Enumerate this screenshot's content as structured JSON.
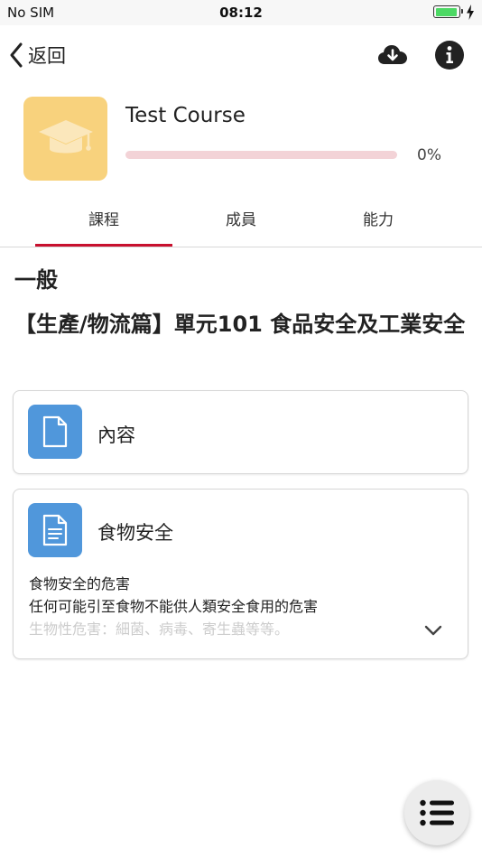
{
  "status_bar": {
    "carrier": "No SIM",
    "time": "08:12",
    "battery_color": "#4cd964"
  },
  "header": {
    "back_label": "返回",
    "download_icon": "cloud-download-icon",
    "info_icon": "info-icon"
  },
  "course": {
    "title": "Test Course",
    "progress_text": "0%",
    "progress_value": 0,
    "image_color": "#f8d27d",
    "image_icon": "graduation-cap-icon"
  },
  "tabs": [
    {
      "label": "課程",
      "active": true
    },
    {
      "label": "成員",
      "active": false
    },
    {
      "label": "能力",
      "active": false
    }
  ],
  "section": {
    "title": "一般",
    "module_heading": "【生產/物流篇】單元101 食品安全及工業安全"
  },
  "activities": [
    {
      "title": "內容",
      "icon": "file-icon"
    },
    {
      "title": "食物安全",
      "icon": "file-text-icon",
      "description": [
        "食物安全的危害",
        "任何可能引至食物不能供人類安全食用的危害",
        "生物性危害：細菌、病毒、寄生蟲等等。"
      ]
    }
  ],
  "fab": {
    "icon": "list-icon"
  },
  "colors": {
    "accent": "#c8102e",
    "activity_icon_bg": "#5097db"
  }
}
